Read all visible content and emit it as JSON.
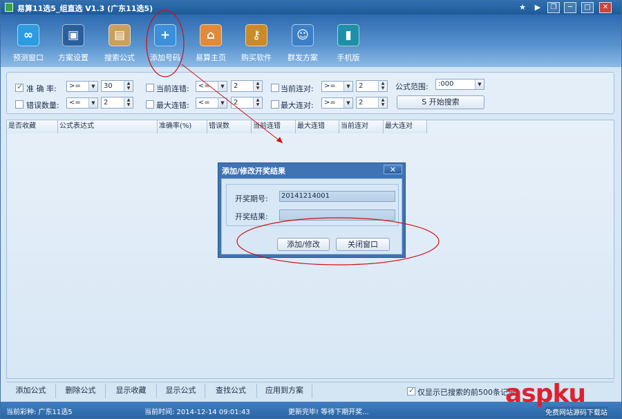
{
  "window": {
    "title": "易算11选5_组直选 V1.3 (广东11选5)",
    "controls": [
      "★",
      "▶",
      "❐",
      "─",
      "□",
      "✕"
    ]
  },
  "toolbar": {
    "items": [
      {
        "label": "预测窗口",
        "icon": "prediction-window-icon",
        "color": "#2c9be0",
        "glyph": "∞"
      },
      {
        "label": "方案设置",
        "icon": "monitor-icon",
        "color": "#2a5f9e",
        "glyph": "▣"
      },
      {
        "label": "搜索公式",
        "icon": "calendar-search-icon",
        "color": "#c9a05e",
        "glyph": "▤"
      },
      {
        "label": "添加号码",
        "icon": "folder-add-icon",
        "color": "#3c8fd8",
        "glyph": "+"
      },
      {
        "label": "易算主页",
        "icon": "home-icon",
        "color": "#e08a3c",
        "glyph": "⌂"
      },
      {
        "label": "购买软件",
        "icon": "key-icon",
        "color": "#c98a2a",
        "glyph": "⚷"
      },
      {
        "label": "群发方案",
        "icon": "group-users-icon",
        "color": "#3a7fc8",
        "glyph": "☺"
      },
      {
        "label": "手机版",
        "icon": "mobile-icon",
        "color": "#1e8fa8",
        "glyph": "▮"
      }
    ]
  },
  "filters": {
    "accuracy": {
      "label": "准 确 率:",
      "checked": true,
      "op": ">=",
      "value": "30"
    },
    "errors": {
      "label": "错误数量:",
      "checked": false,
      "op": "<=",
      "value": "2"
    },
    "cur_miss": {
      "label": "当前连错:",
      "checked": false,
      "op": "<=",
      "value": "2"
    },
    "max_miss": {
      "label": "最大连错:",
      "checked": false,
      "op": "<=",
      "value": "2"
    },
    "cur_hit": {
      "label": "当前连对:",
      "checked": false,
      "op": ">=",
      "value": "2"
    },
    "max_hit": {
      "label": "最大连对:",
      "checked": false,
      "op": ">=",
      "value": "2"
    },
    "range": {
      "label": "公式范围:",
      "value": ":000"
    },
    "search_button": "S 开始搜索"
  },
  "grid": {
    "columns": [
      "是否收藏",
      "公式表达式",
      "准确率(%)",
      "错误数",
      "当前连错",
      "最大连错",
      "当前连对",
      "最大连对"
    ]
  },
  "bottom": {
    "buttons": [
      "添加公式",
      "删除公式",
      "显示收藏",
      "显示公式",
      "查找公式",
      "应用到方案"
    ],
    "show_only_checkbox": {
      "checked": true,
      "label": "仅显示已搜索的前500条记录"
    }
  },
  "status": {
    "lottery": "当前彩种: 广东11选5",
    "time": "当前时间: 2014-12-14 09:01:43",
    "message": "更新完毕! 等待下期开奖..."
  },
  "dialog": {
    "title": "添加/修改开奖结果",
    "close": "✕",
    "period_label": "开奖期号:",
    "period_value": "20141214001",
    "result_label": "开奖结果:",
    "result_value": "",
    "add_button": "添加/修改",
    "close_button": "关闭窗口"
  },
  "watermark": {
    "logo": "aspku",
    "tagline": "免费网站源码下载站"
  }
}
